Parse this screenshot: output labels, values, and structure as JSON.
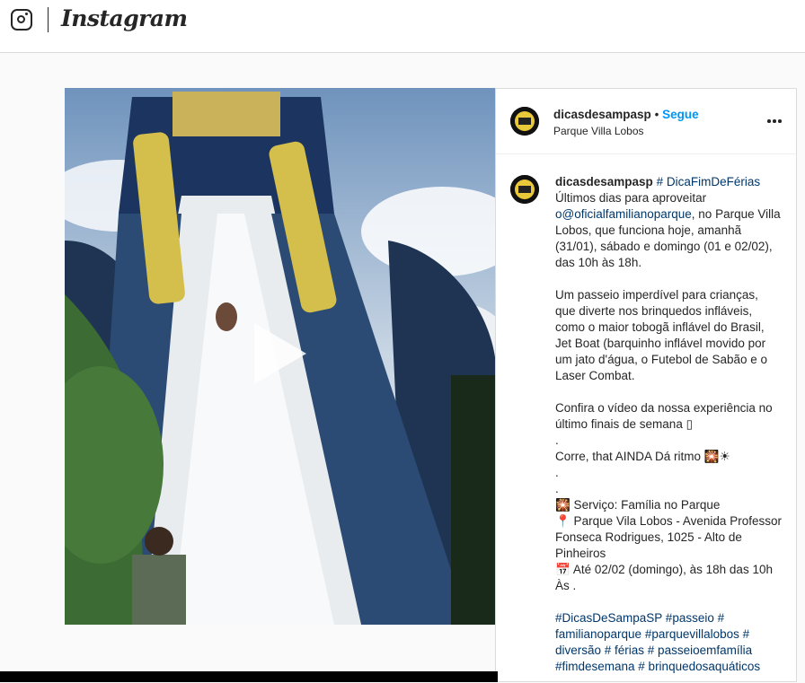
{
  "header": {
    "wordmark": "Instagram",
    "icon": "instagram-camera-icon"
  },
  "post": {
    "username": "dicasdesampasp",
    "separator": "•",
    "follow_label": "Segue",
    "location": "Parque Villa Lobos",
    "more_icon": "more-options-icon",
    "media_icon": "play-icon",
    "caption": {
      "username": "dicasdesampasp",
      "first_hashtag": "# DicaFimDeFérias",
      "line_intro": "Últimos dias para aproveitar",
      "mention": "o@oficialfamilianoparque",
      "after_mention": ", no Parque Villa Lobos, que funciona hoje, amanhã (31/01), sábado e domingo (01 e 02/02), das 10h às 18h.",
      "para2": "Um passeio imperdível para crianças, que diverte nos brinquedos infláveis, como o maior tobogã inflável do Brasil, Jet Boat (barquinho inflável movido por um jato d'água, o Futebol de Sabão e o Laser Combat.",
      "para3": "Confira o vídeo da nossa experiência no último finais de semana ▯",
      "dot1": ".",
      "line_ritmo": "Corre, that AINDA Dá ritmo 🎇☀",
      "dot2": ".",
      "dot3": ".",
      "servico": "🎇 Serviço: Família no Parque",
      "endereco": "📍 Parque Vila Lobos - Avenida Professor Fonseca Rodrigues, 1025 - Alto de Pinheiros",
      "horario": "📅 Até 02/02 (domingo), às 18h das 10h Às .",
      "hashtags": "#DicasDeSampaSP #passeio # familianoparque #parquevillalobos # diversão # férias # passeioemfamília #fimdesemana # brinquedosaquáticos"
    }
  }
}
